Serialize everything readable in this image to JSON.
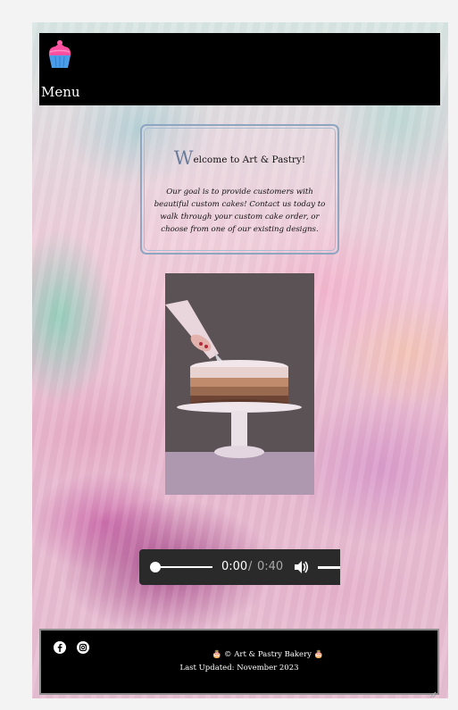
{
  "header": {
    "logo_icon": "cupcake-icon",
    "menu_label": "Menu"
  },
  "welcome": {
    "title_first_letter": "W",
    "title_rest": "elcome to Art & Pastry!",
    "text": "Our goal is to provide customers with beautiful custom cakes! Contact us today to walk through your custom cake order, or choose from one of our existing designs."
  },
  "media": {
    "image_icon": "cake-decorating-photo",
    "audio": {
      "current_time": "0:00",
      "separator": "/",
      "total_time": "0:40",
      "progress": 0
    }
  },
  "footer": {
    "social_icons": [
      "facebook-icon",
      "instagram-icon"
    ],
    "copyright": "🎂 © Art & Pastry Bakery 🎂",
    "last_updated": "Last Updated: November 2023"
  },
  "colors": {
    "header_bg": "#000000",
    "box_border": "#8ea6c2",
    "player_bg": "#2b2a2b"
  }
}
